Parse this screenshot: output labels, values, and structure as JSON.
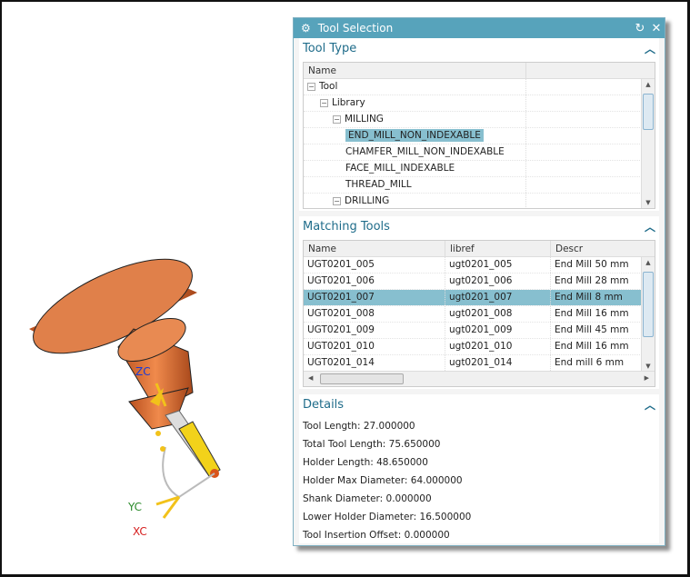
{
  "dialog": {
    "title": "Tool Selection",
    "reset_icon": "reset-icon",
    "close_icon": "close-icon"
  },
  "tool_type": {
    "title": "Tool Type",
    "column": "Name",
    "tree": [
      {
        "label": "Tool",
        "level": 0,
        "expand": "−"
      },
      {
        "label": "Library",
        "level": 1,
        "expand": "−"
      },
      {
        "label": "MILLING",
        "level": 2,
        "expand": "−"
      },
      {
        "label": "END_MILL_NON_INDEXABLE",
        "level": 3,
        "selected": true
      },
      {
        "label": "CHAMFER_MILL_NON_INDEXABLE",
        "level": 3
      },
      {
        "label": "FACE_MILL_INDEXABLE",
        "level": 3
      },
      {
        "label": "THREAD_MILL",
        "level": 3
      },
      {
        "label": "DRILLING",
        "level": 2,
        "expand": "−"
      }
    ]
  },
  "matching": {
    "title": "Matching Tools",
    "columns": [
      "Name",
      "libref",
      "Descr"
    ],
    "rows": [
      [
        "UGT0201_005",
        "ugt0201_005",
        "End Mill 50 mm"
      ],
      [
        "UGT0201_006",
        "ugt0201_006",
        "End Mill 28 mm"
      ],
      [
        "UGT0201_007",
        "ugt0201_007",
        "End Mill 8 mm"
      ],
      [
        "UGT0201_008",
        "ugt0201_008",
        "End Mill 16 mm"
      ],
      [
        "UGT0201_009",
        "ugt0201_009",
        "End Mill 45 mm"
      ],
      [
        "UGT0201_010",
        "ugt0201_010",
        "End Mill 16 mm"
      ],
      [
        "UGT0201_014",
        "ugt0201_014",
        "End mill 6 mm"
      ]
    ],
    "selected_index": 2
  },
  "details": {
    "title": "Details",
    "lines": [
      "Tool Length: 27.000000",
      "Total Tool Length: 75.650000",
      "Holder Length: 48.650000",
      "Holder Max Diameter: 64.000000",
      "Shank Diameter: 0.000000",
      "Lower Holder Diameter: 16.500000",
      "Tool Insertion Offset: 0.000000"
    ]
  },
  "axes": {
    "z": "ZC",
    "y": "YC",
    "x": "XC"
  },
  "colors": {
    "title_bar": "#57a3bb",
    "selection": "#87bfcf",
    "holder": "#d9743a",
    "tool": "#f2d21a"
  }
}
